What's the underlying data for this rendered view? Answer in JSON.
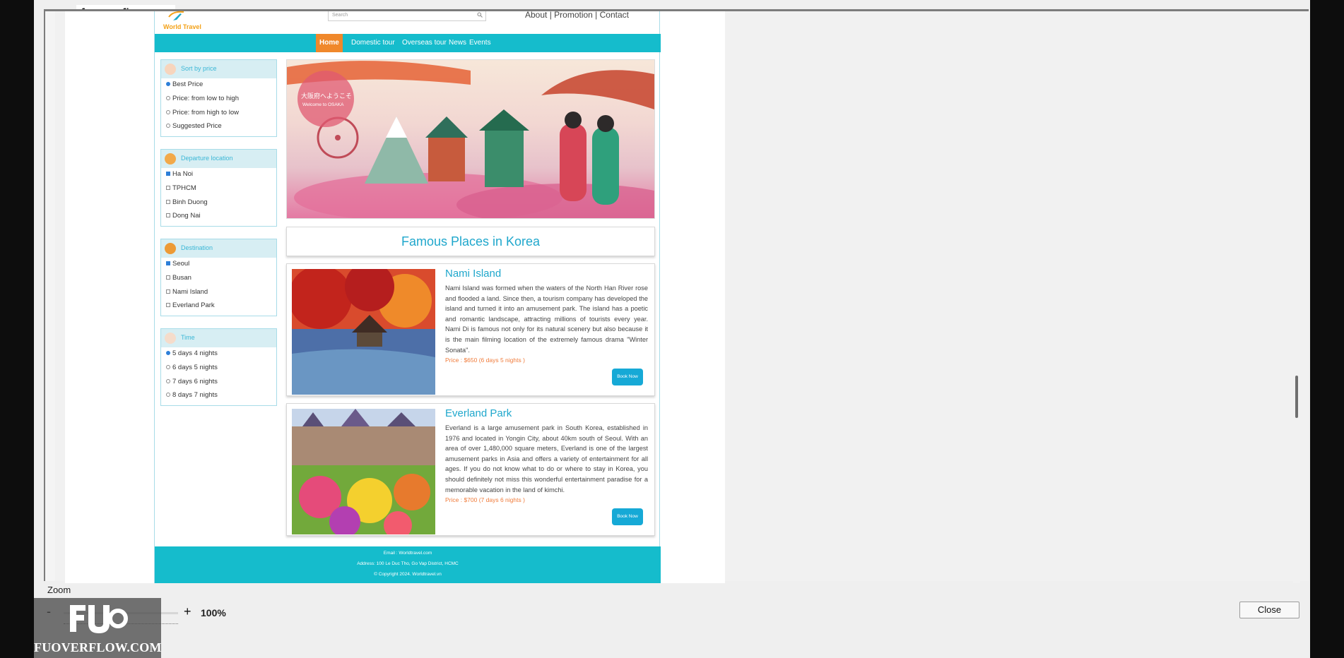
{
  "preview_badge": "fuoverflow",
  "site": {
    "logo": "World Travel",
    "search_placeholder": "Search",
    "top_links": "About | Promotion | Contact",
    "nav": [
      "Home",
      "Domestic tour",
      "Overseas tour",
      "News",
      "Events"
    ],
    "filters": {
      "sort": {
        "title": "Sort by price",
        "options": [
          "Best Price",
          "Price: from low to high",
          "Price: from high to low",
          "Suggested Price"
        ],
        "selected": "Best Price"
      },
      "departure": {
        "title": "Departure location",
        "options": [
          "Ha Noi",
          "TPHCM",
          "Binh Duong",
          "Dong Nai"
        ],
        "selected": "Ha Noi"
      },
      "destination": {
        "title": "Destination",
        "options": [
          "Seoul",
          "Busan",
          "Nami Island",
          "Everland Park"
        ],
        "selected": "Seoul"
      },
      "time": {
        "title": "Time",
        "options": [
          "5 days 4 nights",
          "6 days 5 nights",
          "7 days 6 nights",
          "8 days 7 nights"
        ],
        "selected": "5 days 4 nights"
      }
    },
    "banner": {
      "sign_jp": "大阪府へようこそ",
      "sign_en": "Welcome to OSAKA"
    },
    "section_title": "Famous Places in Korea",
    "places": [
      {
        "name": "Nami Island",
        "description": "Nami Island was formed when the waters of the North Han River rose and flooded a land. Since then, a tourism company has developed the island and turned it into an amusement park. The island has a poetic and romantic landscape, attracting millions of tourists every year. Nami Di is famous not only for its natural scenery but also because it is the main filming location of the extremely famous drama \"Winter Sonata\".",
        "price": "Price : $650 (6 days 5 nights )",
        "button": "Book Now"
      },
      {
        "name": "Everland Park",
        "description": "Everland is a large amusement park in South Korea, established in 1976 and located in Yongin City, about 40km south of Seoul. With an area of over 1,480,000 square meters, Everland is one of the largest amusement parks in Asia and offers a variety of entertainment for all ages. If you do not know what to do or where to stay in Korea, you should definitely not miss this wonderful entertainment paradise for a memorable vacation in the land of kimchi.",
        "price": "Price : $700 (7 days 6 nights )",
        "button": "Book Now"
      }
    ],
    "footer": {
      "email": "Email : Worldtravel.com",
      "address": "Address: 100 Le Duc Tho, Go Vap District, HCMC",
      "copyright": "© Copyright 2024. Worldtravel.vn"
    }
  },
  "bottom": {
    "zoom_label": "Zoom",
    "zoom_minus": "-",
    "zoom_plus": "+",
    "zoom_value": "100%",
    "watermark": "FUOVERFLOW.COM",
    "close": "Close"
  },
  "colors": {
    "nav_bg": "#15bccc",
    "nav_active": "#f0882b",
    "accent_blue": "#1fa7cc",
    "price_orange": "#f07b3a",
    "button_blue": "#16a9d6"
  }
}
